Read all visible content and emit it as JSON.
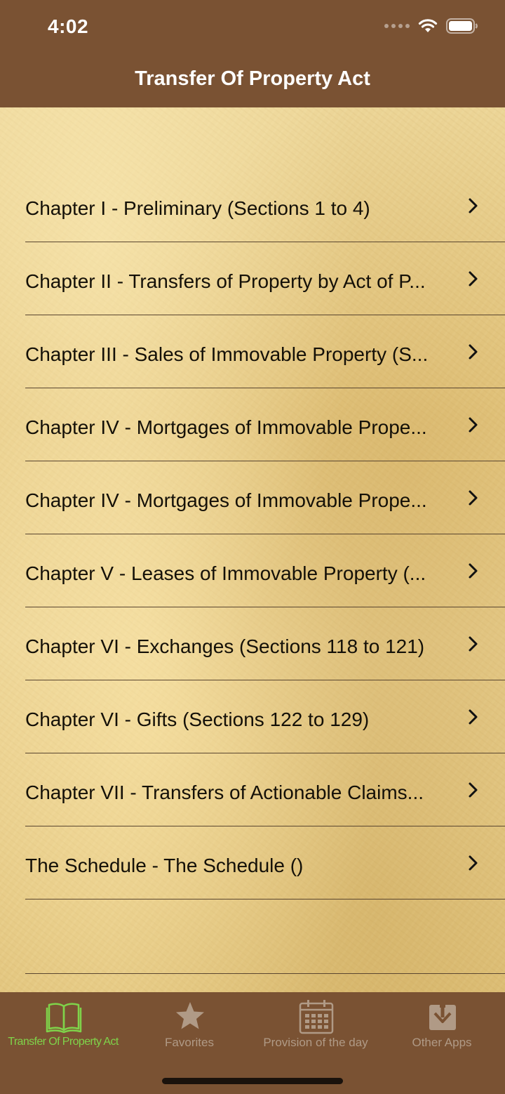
{
  "status_bar": {
    "time": "4:02",
    "signal_icon": "signal-dots-icon",
    "wifi_icon": "wifi-icon",
    "battery_icon": "battery-icon"
  },
  "nav": {
    "title": "Transfer Of Property Act"
  },
  "chapters": [
    {
      "label": "Chapter I - Preliminary (Sections 1 to 4)"
    },
    {
      "label": "Chapter II - Transfers of Property by Act of P..."
    },
    {
      "label": "Chapter III - Sales of Immovable Property (S..."
    },
    {
      "label": "Chapter IV - Mortgages of Immovable Prope..."
    },
    {
      "label": "Chapter IV - Mortgages of Immovable Prope..."
    },
    {
      "label": "Chapter V - Leases of Immovable Property (..."
    },
    {
      "label": "Chapter VI - Exchanges (Sections 118 to 121)"
    },
    {
      "label": "Chapter VI - Gifts (Sections 122 to 129)"
    },
    {
      "label": "Chapter VII - Transfers of Actionable Claims..."
    },
    {
      "label": "The Schedule - The Schedule ()"
    }
  ],
  "tabbar": {
    "tabs": [
      {
        "label": "Transfer Of Property Act",
        "icon": "book-icon",
        "active": true
      },
      {
        "label": "Favorites",
        "icon": "star-icon",
        "active": false
      },
      {
        "label": "Provision of the day",
        "icon": "calendar-icon",
        "active": false
      },
      {
        "label": "Other Apps",
        "icon": "download-icon",
        "active": false
      }
    ]
  },
  "colors": {
    "bar_brown": "#7a5233",
    "active_tab_green": "#7fd34a",
    "inactive_tab": "#b09a86",
    "parchment": "#e8cf8e"
  }
}
